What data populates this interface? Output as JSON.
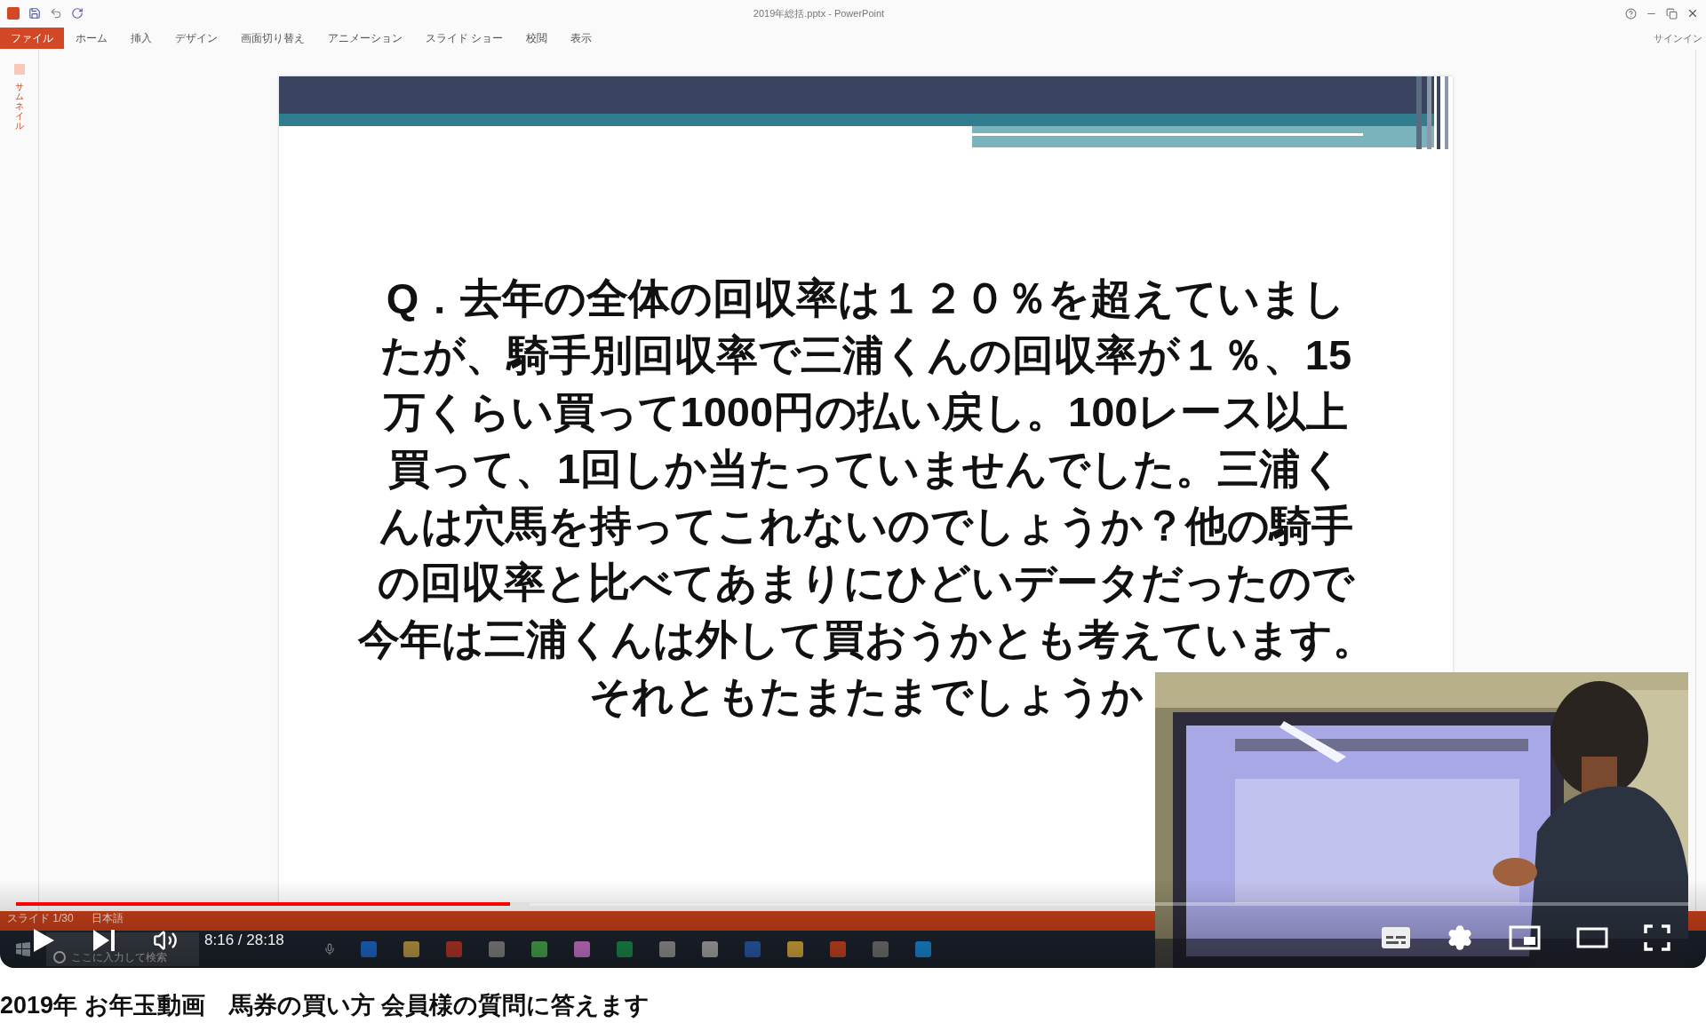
{
  "powerpoint": {
    "title": "2019年総括.pptx - PowerPoint",
    "ribbon_tabs": [
      {
        "label": "ファイル",
        "selected": true
      },
      {
        "label": "ホーム",
        "selected": false
      },
      {
        "label": "挿入",
        "selected": false
      },
      {
        "label": "デザイン",
        "selected": false
      },
      {
        "label": "画面切り替え",
        "selected": false
      },
      {
        "label": "アニメーション",
        "selected": false
      },
      {
        "label": "スライド ショー",
        "selected": false
      },
      {
        "label": "校閲",
        "selected": false
      },
      {
        "label": "表示",
        "selected": false
      }
    ],
    "signin": "サインイン",
    "thumbnail_pane_label": "サムネイル",
    "slide": {
      "lines": [
        "Q．去年の全体の回収率は１２０％を超えていまし",
        "たが、騎手別回収率で三浦くんの回収率が１％、15",
        "万くらい買って1000円の払い戻し。100レース以上",
        "買って、1回しか当たっていませんでした。三浦く",
        "んは穴馬を持ってこれないのでしょうか？他の騎手",
        "の回収率と比べてあまりにひどいデータだったので",
        "今年は三浦くんは外して買おうかとも考えています。",
        "それともたまたまでしょうか"
      ]
    },
    "status_bar": {
      "slide": "スライド 1/30",
      "language": "日本語"
    }
  },
  "taskbar": {
    "search_placeholder": "ここに入力して検索"
  },
  "player": {
    "progress": {
      "level": 0.295
    },
    "buffer": {
      "level": 0.307
    },
    "time": "8:16 / 28:18"
  },
  "video_title": "2019年 お年玉動画　馬券の買い方 会員様の質問に答えます"
}
